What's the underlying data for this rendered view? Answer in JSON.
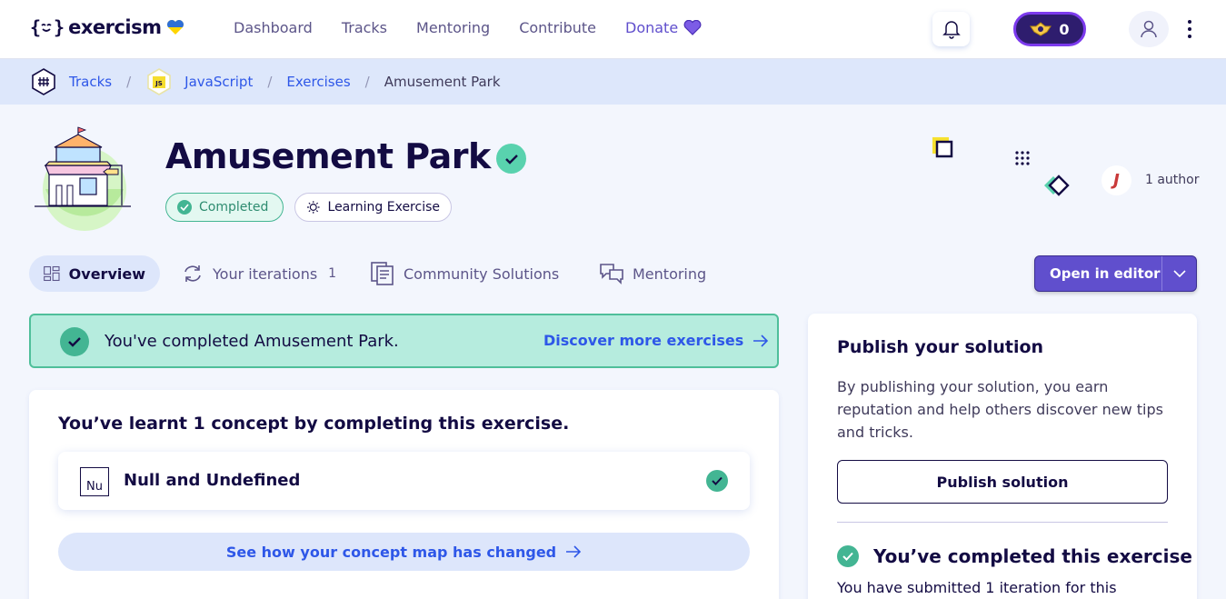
{
  "nav": {
    "logo_text": "exercism",
    "links": [
      "Dashboard",
      "Tracks",
      "Mentoring",
      "Contribute"
    ],
    "donate_label": "Donate",
    "reputation": "0"
  },
  "breadcrumb": {
    "tracks": "Tracks",
    "track_badge": "JS",
    "track": "JavaScript",
    "exercises": "Exercises",
    "current": "Amusement Park",
    "separator": "/"
  },
  "exercise": {
    "title": "Amusement Park",
    "status_tag": "Completed",
    "type_tag": "Learning Exercise",
    "authors": "1 author",
    "author_initial": "J"
  },
  "tabs": {
    "overview": "Overview",
    "iterations": "Your iterations",
    "iterations_count": "1",
    "community": "Community Solutions",
    "mentoring": "Mentoring",
    "open_editor": "Open in editor"
  },
  "banner": {
    "text": "You've completed Amusement Park.",
    "link": "Discover more exercises"
  },
  "concepts": {
    "title": "You’ve learnt 1 concept by completing this exercise.",
    "items": [
      {
        "abbr": "Nu",
        "name": "Null and Undefined"
      }
    ],
    "map_link": "See how your concept map has changed"
  },
  "publish": {
    "title": "Publish your solution",
    "description": "By publishing your solution, you earn reputation and help others discover new tips and tricks.",
    "button": "Publish solution",
    "completed_title": "You’ve completed this exercise",
    "completed_sub": "You have submitted 1 iteration for this"
  },
  "colors": {
    "accent": "#604fcd",
    "link": "#2e57e8",
    "success": "#43b593",
    "banner_bg": "#b6ecde"
  }
}
